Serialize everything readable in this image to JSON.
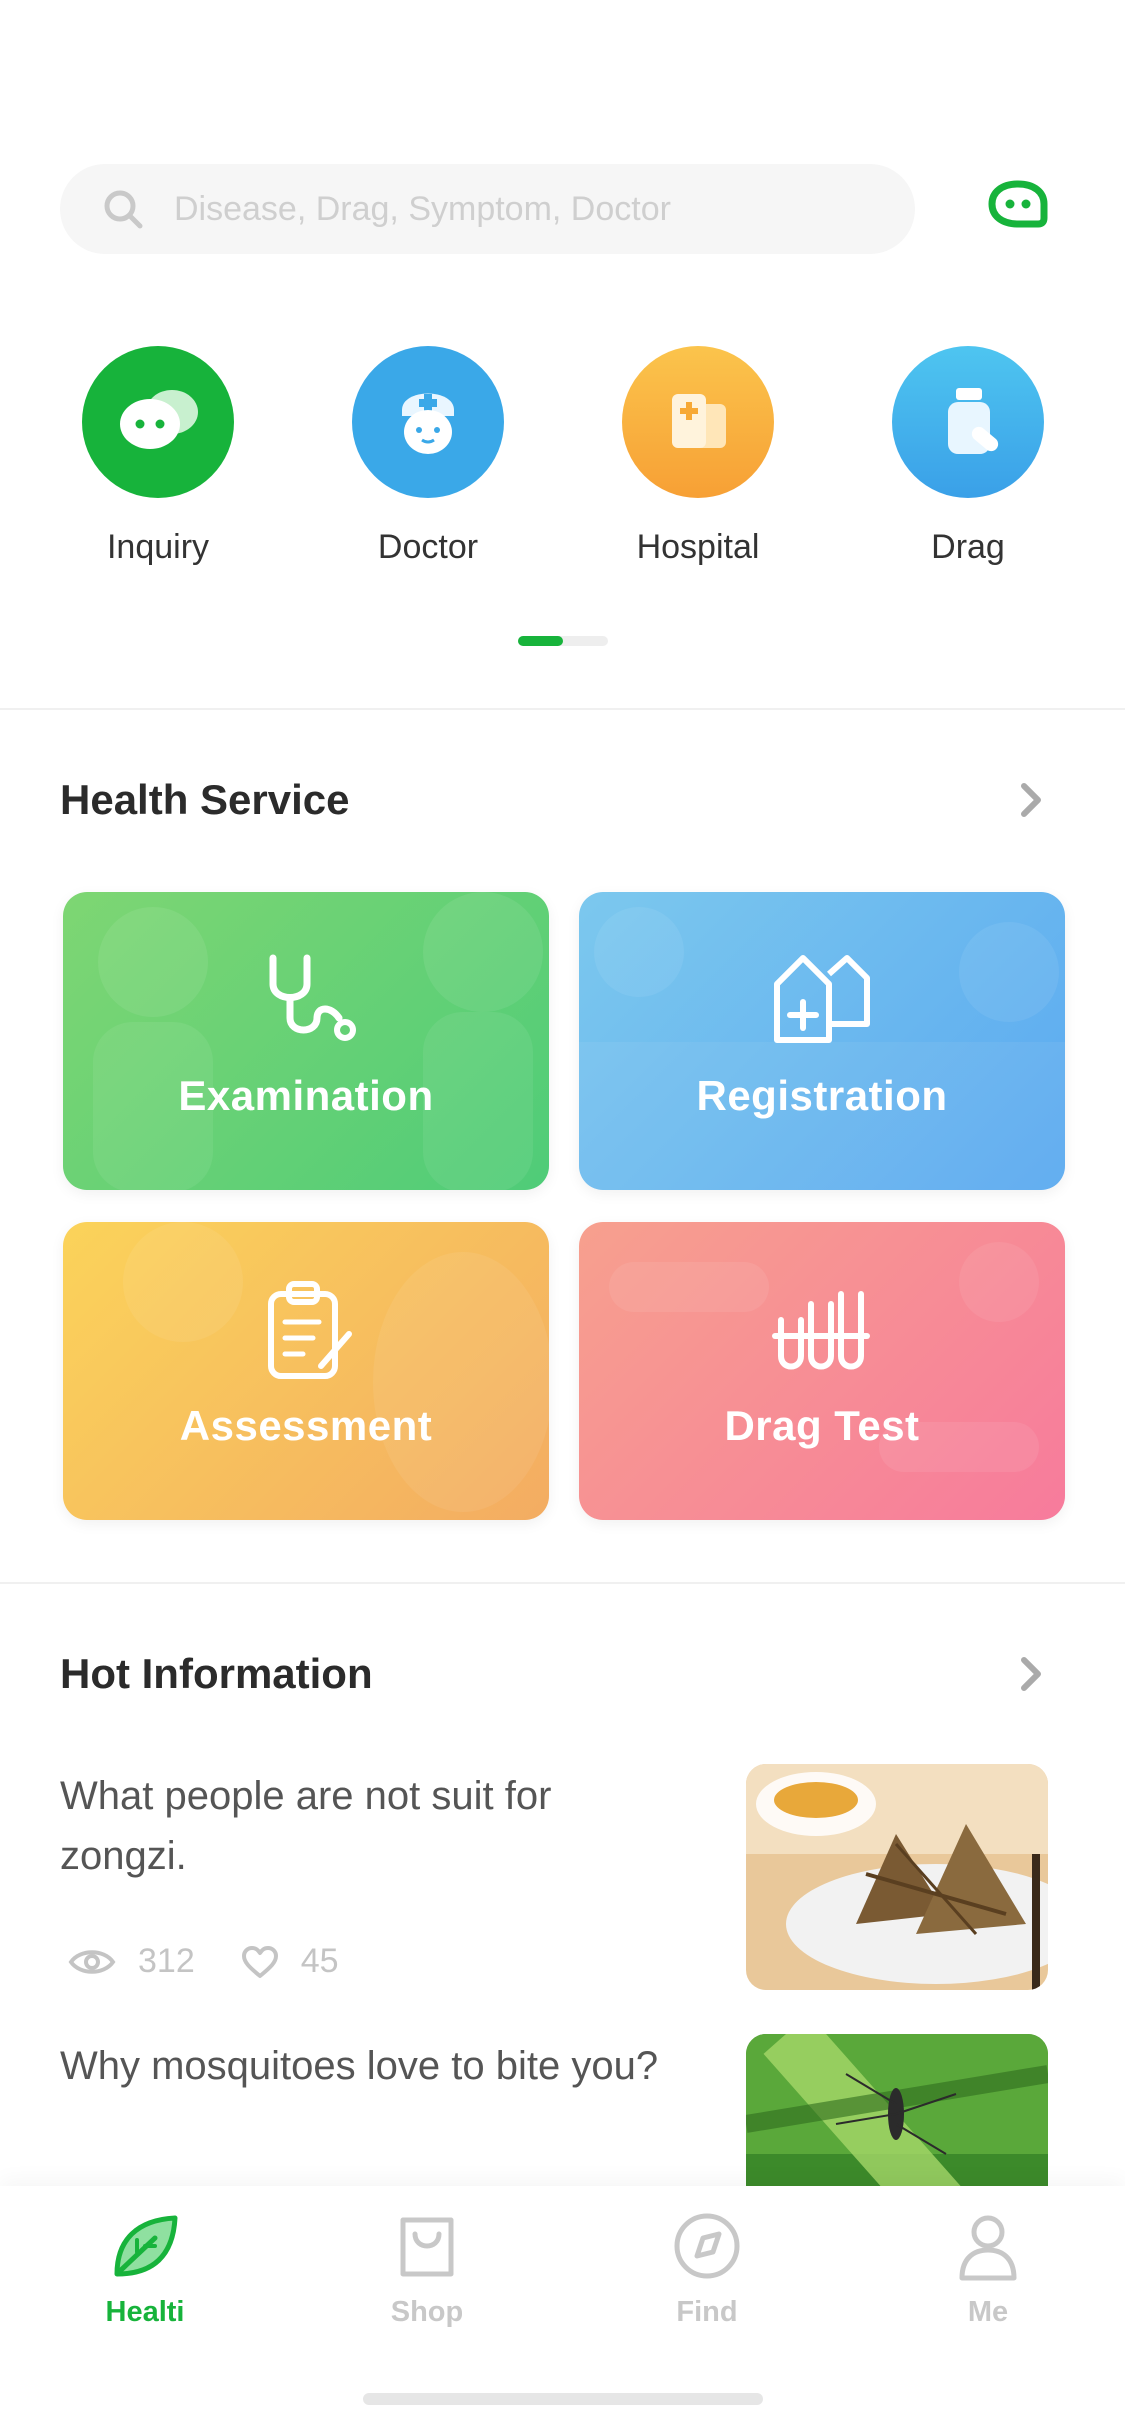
{
  "search": {
    "placeholder": "Disease, Drag, Symptom, Doctor",
    "icon": "search-icon"
  },
  "header": {
    "chat_icon": "chat-bubble-icon",
    "accent": "#17b33b"
  },
  "quick_entries": [
    {
      "label": "Inquiry",
      "icon": "chat-bubbles-icon",
      "color": "#17b33b"
    },
    {
      "label": "Doctor",
      "icon": "doctor-icon",
      "color": "#3aa8e8"
    },
    {
      "label": "Hospital",
      "icon": "hospital-icon",
      "color": "#f7a935"
    },
    {
      "label": "Drag",
      "icon": "medicine-bottle-icon",
      "color": "#3aaee8"
    }
  ],
  "health_service": {
    "title": "Health Service",
    "cards": [
      {
        "label": "Examination",
        "icon": "stethoscope-icon"
      },
      {
        "label": "Registration",
        "icon": "hospital-building-icon"
      },
      {
        "label": "Assessment",
        "icon": "clipboard-icon"
      },
      {
        "label": "Drag Test",
        "icon": "test-tubes-icon"
      }
    ]
  },
  "hot_information": {
    "title": "Hot Information",
    "articles": [
      {
        "title": "What people are not suit for zongzi.",
        "views": "312",
        "likes": "45"
      },
      {
        "title": "Why mosquitoes love to bite you?"
      }
    ]
  },
  "tabbar": {
    "items": [
      {
        "label": "Healti",
        "icon": "leaf-icon",
        "active": true
      },
      {
        "label": "Shop",
        "icon": "shopping-bag-icon"
      },
      {
        "label": "Find",
        "icon": "compass-icon"
      },
      {
        "label": "Me",
        "icon": "person-icon"
      }
    ],
    "active_color": "#17b33b",
    "inactive_color": "#c8c8c8"
  }
}
